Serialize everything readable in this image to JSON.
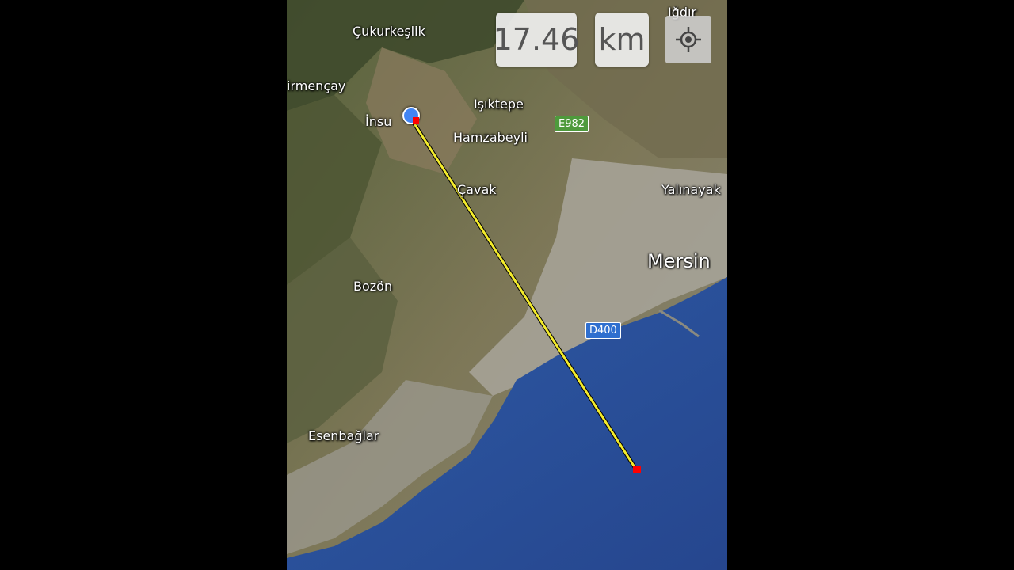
{
  "measure": {
    "distance": "17.46",
    "unit": "km"
  },
  "controls": {
    "locate_icon": "crosshair-icon"
  },
  "places": {
    "cukurkeslik": "Çukurkeşlik",
    "degirmencay": "irmençay",
    "isiktepe": "Işıktepe",
    "insu": "İnsu",
    "hamzabeyli": "Hamzabeyli",
    "cavak": "Çavak",
    "yalinayak": "Yalınayak",
    "mersin": "Mersin",
    "bozon": "Bozön",
    "esenbaglar": "Esenbağlar",
    "igdir": "Iğdır"
  },
  "roads": {
    "e982": "E982",
    "d400": "D400"
  },
  "colors": {
    "line": "#f4ec2c",
    "start_marker": "#4285f4",
    "end_marker": "#ff0000",
    "sea": "#2b4f9a"
  }
}
